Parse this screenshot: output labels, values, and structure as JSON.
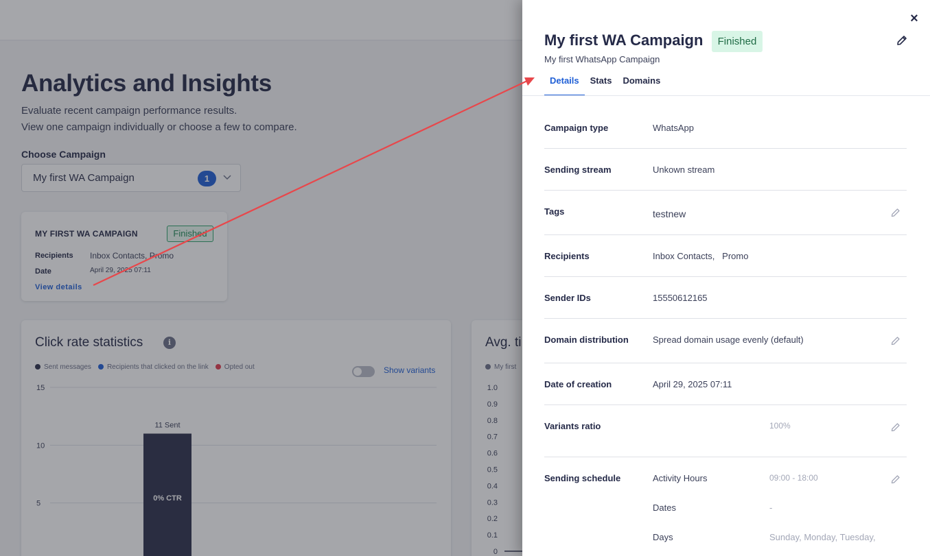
{
  "background": {
    "page_title": "Analytics and Insights",
    "subtitle_line1": "Evaluate recent campaign performance results.",
    "subtitle_line2": "View one campaign individually or choose a few to compare.",
    "choose_label": "Choose Campaign",
    "choose_value": "My first WA Campaign",
    "choose_count": "1",
    "campaign_card": {
      "name": "MY FIRST WA CAMPAIGN",
      "status": "Finished",
      "recipients_label": "Recipients",
      "recipients_value": "Inbox Contacts,  Promo",
      "date_label": "Date",
      "date_value": "April 29, 2025 07:11",
      "link": "View details"
    },
    "click_stats": {
      "title": "Click rate statistics",
      "info": "i",
      "legend": [
        {
          "label": "Sent messages",
          "color": "#2b2f4a"
        },
        {
          "label": "Recipients that clicked on the link",
          "color": "#1f5fd6"
        },
        {
          "label": "Opted out",
          "color": "#e23b4e"
        }
      ],
      "show_variants": "Show variants",
      "bar_label": "11 Sent",
      "bar_inner_label": "0% CTR"
    },
    "second_card": {
      "title": "Avg. ti",
      "legend": "My first"
    }
  },
  "chart_data": [
    {
      "type": "bar",
      "categories": [
        ""
      ],
      "series": [
        {
          "name": "Sent messages",
          "values": [
            11
          ]
        }
      ],
      "yticks": [
        "15",
        "10",
        "5"
      ],
      "ylim": [
        0,
        15
      ]
    },
    {
      "type": "line",
      "yticks": [
        "1.0",
        "0.9",
        "0.8",
        "0.7",
        "0.6",
        "0.5",
        "0.4",
        "0.3",
        "0.2",
        "0.1",
        "0"
      ],
      "ylim": [
        0,
        1.0
      ]
    }
  ],
  "drawer": {
    "title": "My first WA Campaign",
    "status": "Finished",
    "subtitle": "My first WhatsApp Campaign",
    "close": "×",
    "tabs": [
      {
        "label": "Details"
      },
      {
        "label": "Stats"
      },
      {
        "label": "Domains"
      }
    ],
    "rows": {
      "campaign_type": {
        "label": "Campaign type",
        "value": "WhatsApp"
      },
      "sending_stream": {
        "label": "Sending stream",
        "value": "Unkown stream"
      },
      "tags": {
        "label": "Tags",
        "value": "testnew"
      },
      "recipients": {
        "label": "Recipients",
        "value": "Inbox Contacts,   Promo"
      },
      "sender_ids": {
        "label": "Sender IDs",
        "value": "15550612165"
      },
      "domain_distribution": {
        "label": "Domain distribution",
        "value": "Spread domain usage evenly (default)"
      },
      "date_of_creation": {
        "label": "Date of creation",
        "value": "April 29, 2025 07:11"
      },
      "variants_ratio": {
        "label": "Variants ratio",
        "value": "100%"
      },
      "sending_schedule": {
        "label": "Sending schedule",
        "activity_label": "Activity Hours",
        "activity_value": "09:00 - 18:00",
        "dates_label": "Dates",
        "dates_value": "-",
        "days_label": "Days",
        "days_value": "Sunday, Monday, Tuesday,"
      }
    }
  },
  "colors": {
    "accent": "#1f5fd6",
    "annotation_arrow": "#e8474b",
    "success_bg": "#d8f5e6",
    "success_text": "#1f6b45"
  }
}
